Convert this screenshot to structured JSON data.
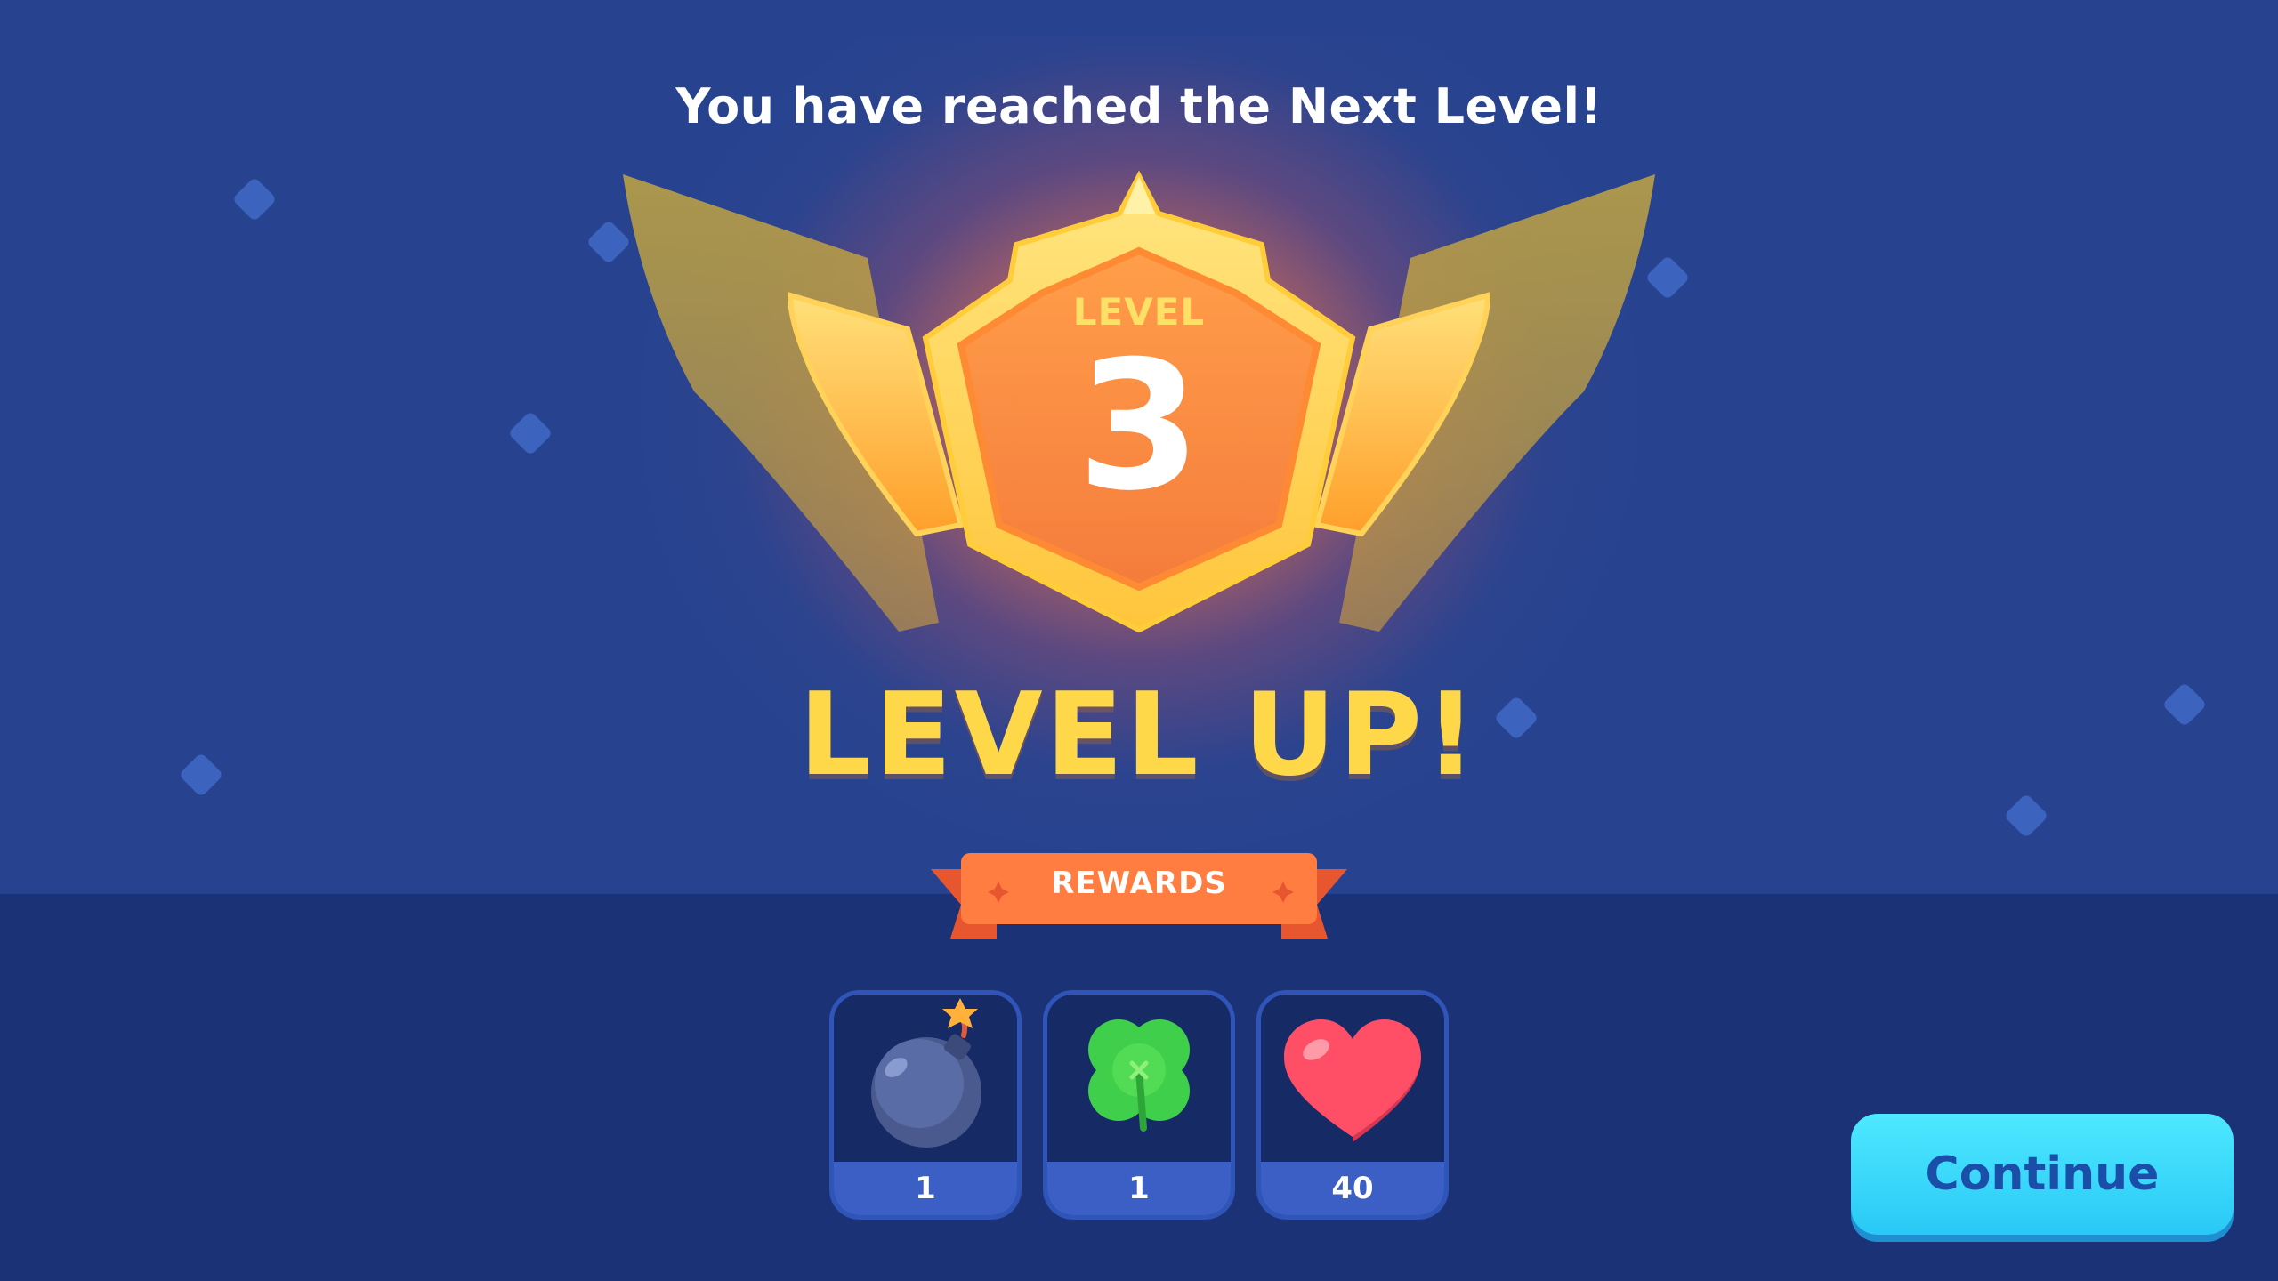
{
  "header": {
    "title": "You have reached the Next Level!"
  },
  "badge": {
    "level_label": "LEVEL",
    "level_number": "3"
  },
  "headline": "LEVEL UP!",
  "rewards": {
    "label": "REWARDS",
    "items": [
      {
        "name": "bomb",
        "icon": "bomb-icon",
        "count": "1"
      },
      {
        "name": "clover",
        "icon": "four-leaf-clover-icon",
        "count": "1"
      },
      {
        "name": "heart",
        "icon": "heart-icon",
        "count": "40"
      }
    ]
  },
  "actions": {
    "continue_label": "Continue"
  },
  "colors": {
    "background": "#27438f",
    "background_lower": "#1b3277",
    "gold": "#ffd84a",
    "badge_orange": "#f9863f",
    "ribbon": "#ff7a3d",
    "button": "#34d4fb",
    "button_text": "#1a4ea8"
  }
}
